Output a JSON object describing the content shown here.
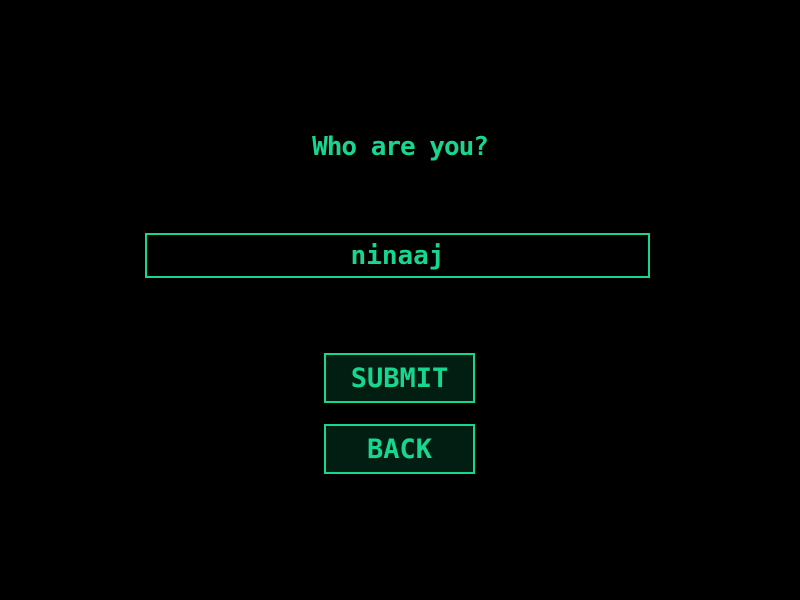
{
  "prompt": {
    "text": "Who are you?"
  },
  "name_input": {
    "value": "ninaaj"
  },
  "buttons": {
    "submit_label": "SUBMIT",
    "back_label": "BACK"
  },
  "colors": {
    "background": "#000000",
    "accent": "#17d690",
    "button_fill": "#021d12"
  }
}
